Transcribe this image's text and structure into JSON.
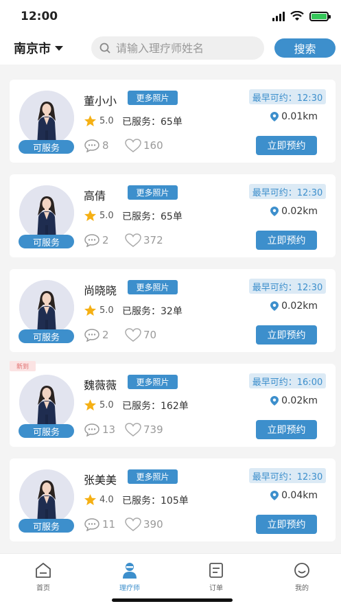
{
  "status_bar": {
    "time": "12:00"
  },
  "header": {
    "city": "南京市",
    "search_placeholder": "请输入理疗师姓名",
    "search_button": "搜索"
  },
  "therapists": [
    {
      "name": "董小小",
      "more_photos": "更多照片",
      "rating": "5.0",
      "served": "已服务：65单",
      "comments": "8",
      "likes": "160",
      "earliest": "最早可约：12:30",
      "distance": "0.01km",
      "status": "可服务",
      "book": "立即预约",
      "new_tag": ""
    },
    {
      "name": "高倩",
      "more_photos": "更多照片",
      "rating": "5.0",
      "served": "已服务：65单",
      "comments": "2",
      "likes": "372",
      "earliest": "最早可约：12:30",
      "distance": "0.02km",
      "status": "可服务",
      "book": "立即预约",
      "new_tag": ""
    },
    {
      "name": "尚晓晓",
      "more_photos": "更多照片",
      "rating": "5.0",
      "served": "已服务：32单",
      "comments": "2",
      "likes": "70",
      "earliest": "最早可约：12:30",
      "distance": "0.02km",
      "status": "可服务",
      "book": "立即预约",
      "new_tag": ""
    },
    {
      "name": "魏薇薇",
      "more_photos": "更多照片",
      "rating": "5.0",
      "served": "已服务：162单",
      "comments": "13",
      "likes": "739",
      "earliest": "最早可约：16:00",
      "distance": "0.02km",
      "status": "可服务",
      "book": "立即预约",
      "new_tag": "新到"
    },
    {
      "name": "张美美",
      "more_photos": "更多照片",
      "rating": "4.0",
      "served": "已服务：105单",
      "comments": "11",
      "likes": "390",
      "earliest": "最早可约：12:30",
      "distance": "0.04km",
      "status": "可服务",
      "book": "立即预约",
      "new_tag": ""
    }
  ],
  "tabbar": [
    {
      "label": "首页",
      "icon": "home-icon",
      "active": false
    },
    {
      "label": "理疗师",
      "icon": "therapist-icon",
      "active": true
    },
    {
      "label": "订单",
      "icon": "order-icon",
      "active": false
    },
    {
      "label": "我的",
      "icon": "profile-icon",
      "active": false
    }
  ],
  "colors": {
    "accent": "#3d8fcc",
    "accent_light": "#dceaf5",
    "new_badge": "#fbe3e3"
  }
}
